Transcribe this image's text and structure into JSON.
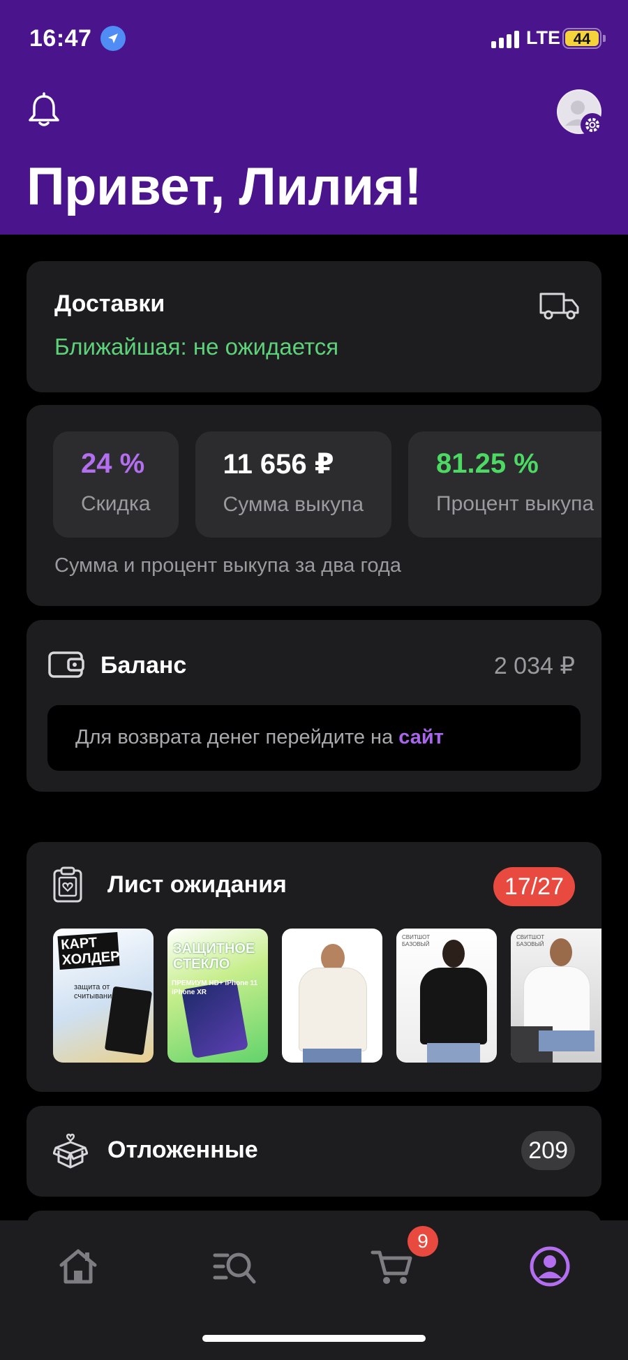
{
  "status_bar": {
    "time": "16:47",
    "network": "LTE",
    "battery": "44"
  },
  "header": {
    "greeting": "Привет, Лилия!"
  },
  "deliveries": {
    "title": "Доставки",
    "nearest": "Ближайшая: не ожидается"
  },
  "stats": {
    "items": [
      {
        "value": "24 %",
        "label": "Скидка",
        "color": "#b46ef0"
      },
      {
        "value": "11 656 ₽",
        "label": "Сумма выкупа",
        "color": "#ffffff"
      },
      {
        "value": "81.25 %",
        "label": "Процент выкупа",
        "color": "#4cd964"
      }
    ],
    "note": "Сумма и процент выкупа за два года"
  },
  "balance": {
    "title": "Баланс",
    "amount": "2 034 ₽",
    "refund_text": "Для возврата денег перейдите на",
    "refund_link": "сайт"
  },
  "waitlist": {
    "title": "Лист ожидания",
    "count": "17/27",
    "thumbs": [
      {
        "name": "cardholder",
        "text": "КАРТ ХОЛДЕР",
        "sub": "защита от считывания"
      },
      {
        "name": "screen-protector",
        "text": "ЗАЩИТНОЕ СТЕКЛО",
        "sub": "ПРЕМИУМ HD+ iPhone 11 iPhone XR"
      },
      {
        "name": "white-sweater",
        "text": "",
        "sub": ""
      },
      {
        "name": "black-sweatshirt",
        "text": "",
        "sub": "СВИТШОТ БАЗОВЫЙ"
      },
      {
        "name": "white-sweatshirt",
        "text": "",
        "sub": "СВИТШОТ БАЗОВЫЙ"
      }
    ]
  },
  "postponed": {
    "title": "Отложенные",
    "count": "209"
  },
  "tabbar": {
    "items": [
      "home-icon",
      "catalog-search-icon",
      "cart-icon",
      "profile-icon"
    ],
    "cart_badge": "9"
  }
}
